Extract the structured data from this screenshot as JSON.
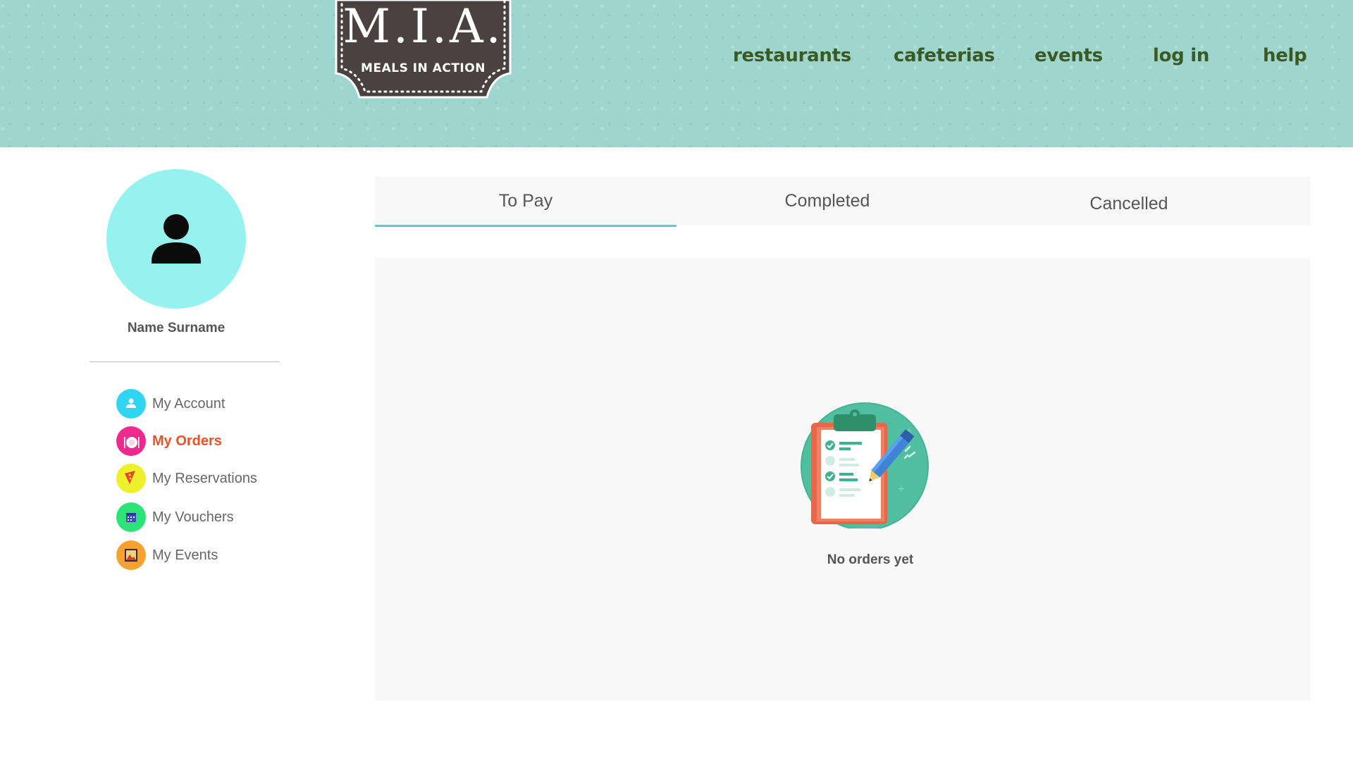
{
  "logo": {
    "title": "M.I.A.",
    "subtitle": "MEALS IN ACTION",
    "color": "#4a4140"
  },
  "nav": {
    "links": [
      {
        "label": "restaurants"
      },
      {
        "label": "cafeterias"
      },
      {
        "label": "events"
      },
      {
        "label": "log in"
      },
      {
        "label": "help"
      }
    ]
  },
  "profile": {
    "name": "Name Surname",
    "avatar_icon": "person-icon"
  },
  "sidebar": {
    "items": [
      {
        "label": "My Account",
        "icon": "person-icon",
        "color": "#2fd6f2",
        "active": false
      },
      {
        "label": "My Orders",
        "icon": "plate-icon",
        "color": "#f0298f",
        "active": true
      },
      {
        "label": "My Reservations",
        "icon": "pizza-slice-icon",
        "color": "#eef02b",
        "active": false
      },
      {
        "label": "My Vouchers",
        "icon": "calendar-icon",
        "color": "#2be378",
        "active": false
      },
      {
        "label": "My Events",
        "icon": "picture-icon",
        "color": "#f6a22e",
        "active": false
      }
    ]
  },
  "tabs": [
    {
      "label": "To Pay",
      "selected": true
    },
    {
      "label": "Completed",
      "selected": false
    },
    {
      "label": "Cancelled",
      "selected": false
    }
  ],
  "content": {
    "empty_icon": "clipboard-checklist-icon",
    "empty_message": "No orders yet"
  },
  "colors": {
    "header_bg": "#9ed6cf",
    "nav_text": "#3b5a23",
    "active_menu": "#f4501f",
    "tab_underline": "#49d9c6",
    "avatar_bg": "#95f2ee"
  }
}
